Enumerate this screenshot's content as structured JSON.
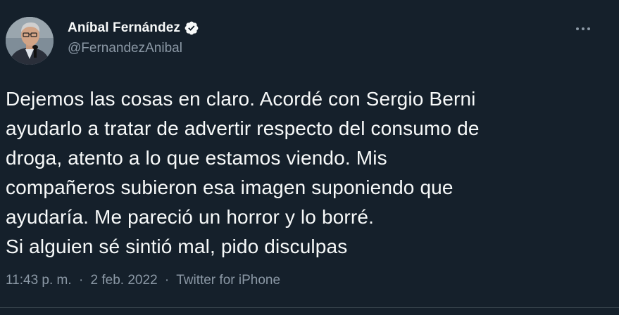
{
  "author": {
    "display_name": "Aníbal Fernández",
    "handle": "@FernandezAnibal",
    "verified_icon": "verified-badge-icon"
  },
  "more_icon": "more-horizontal-icon",
  "tweet": {
    "lines": [
      "Dejemos las cosas en claro. Acordé con Sergio Berni",
      "ayudarlo a tratar de advertir respecto del consumo de",
      "droga, atento a lo que estamos viendo. Mis",
      "compañeros subieron esa imagen suponiendo que",
      "ayudaría. Me pareció un horror y lo borré.",
      "Si alguien sé sintió mal, pido disculpas"
    ]
  },
  "meta": {
    "time": "11:43 p. m.",
    "separator": "·",
    "date": "2 feb. 2022",
    "source": "Twitter for iPhone"
  },
  "colors": {
    "background": "#15202b",
    "primary_text": "#f7f9f9",
    "secondary_text": "#8b98a5",
    "divider": "#38444d"
  }
}
